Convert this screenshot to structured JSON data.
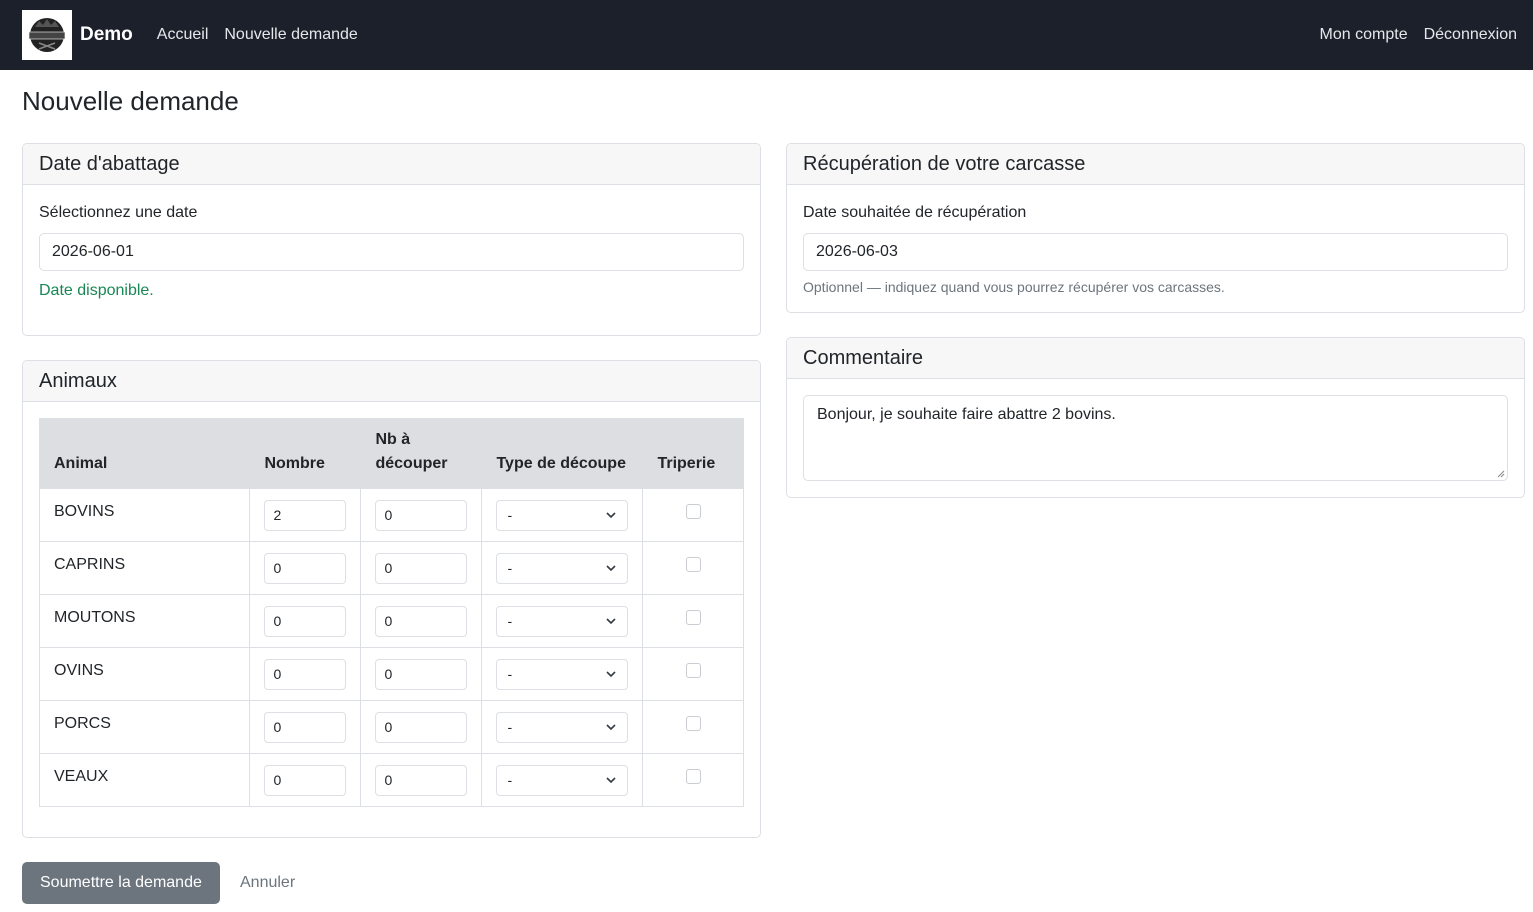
{
  "nav": {
    "brand": "Demo",
    "links": [
      "Accueil",
      "Nouvelle demande"
    ],
    "right_links": [
      "Mon compte",
      "Déconnexion"
    ]
  },
  "page": {
    "title": "Nouvelle demande"
  },
  "date_card": {
    "title": "Date d'abattage",
    "label": "Sélectionnez une date",
    "value": "2026-06-01",
    "status": "Date disponible."
  },
  "recup_card": {
    "title": "Récupération de votre carcasse",
    "label": "Date souhaitée de récupération",
    "value": "2026-06-03",
    "help": "Optionnel — indiquez quand vous pourrez récupérer vos carcasses."
  },
  "comment_card": {
    "title": "Commentaire",
    "value": "Bonjour, je souhaite faire abattre 2 bovins."
  },
  "animals_card": {
    "title": "Animaux",
    "headers": [
      "Animal",
      "Nombre",
      "Nb à découper",
      "Type de découpe",
      "Triperie"
    ],
    "rows": [
      {
        "animal": "BOVINS",
        "nombre": "2",
        "decouper": "0",
        "type": "-"
      },
      {
        "animal": "CAPRINS",
        "nombre": "0",
        "decouper": "0",
        "type": "-"
      },
      {
        "animal": "MOUTONS",
        "nombre": "0",
        "decouper": "0",
        "type": "-"
      },
      {
        "animal": "OVINS",
        "nombre": "0",
        "decouper": "0",
        "type": "-"
      },
      {
        "animal": "PORCS",
        "nombre": "0",
        "decouper": "0",
        "type": "-"
      },
      {
        "animal": "VEAUX",
        "nombre": "0",
        "decouper": "0",
        "type": "-"
      }
    ]
  },
  "actions": {
    "submit": "Soumettre la demande",
    "cancel": "Annuler"
  }
}
